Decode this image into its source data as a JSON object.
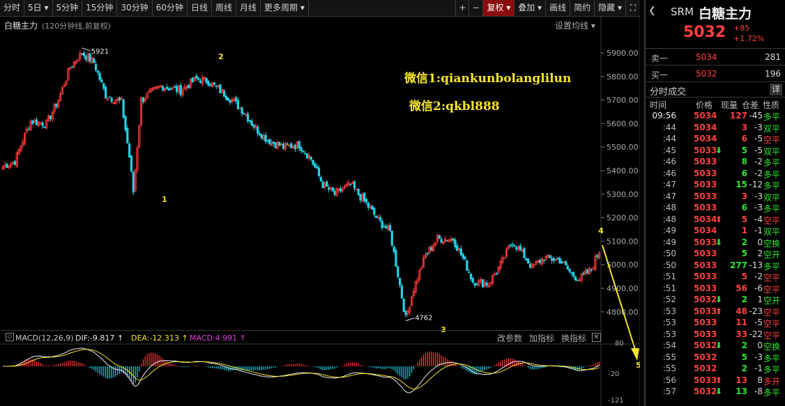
{
  "toolbar": {
    "buttons": [
      "分时",
      "5日 ▾",
      "5分钟",
      "15分钟",
      "30分钟",
      "60分钟",
      "日线",
      "周线",
      "月线",
      "更多周期 ▾"
    ],
    "plus": "+",
    "minus": "−",
    "fq": "复权 ▾",
    "overlay": "叠加 ▾",
    "draw": "画线",
    "simple": "简约",
    "hide": "隐藏 ▾",
    "maximize": "⛶"
  },
  "chart": {
    "title": "白糖主力",
    "subtitle": "(120分钟线,前复权)",
    "ma_setting": "设置均线 ▾",
    "y_ticks": [
      "5900.00",
      "5800.00",
      "5700.00",
      "5600.00",
      "5500.00",
      "5400.00",
      "5300.00",
      "5200.00",
      "5100.00",
      "5000.00",
      "4900.00",
      "4800.00"
    ],
    "high_label": "5921",
    "low_label": "4762",
    "wave_labels": [
      "1",
      "2",
      "3",
      "4",
      "5"
    ],
    "wechat1": "微信1:qiankunbolanglilun",
    "wechat2": "微信2:qkbl888",
    "colors": {
      "up": "#ff3b3b",
      "down": "#22d3e6",
      "annotation": "#f5e62a"
    }
  },
  "chart_data": {
    "type": "candlestick",
    "title": "白糖主力",
    "ylim": [
      4700,
      5960
    ],
    "high": 5921,
    "low": 4762,
    "waypoints": [
      [
        0,
        5420
      ],
      [
        6,
        5440
      ],
      [
        10,
        5530
      ],
      [
        14,
        5610
      ],
      [
        22,
        5600
      ],
      [
        28,
        5700
      ],
      [
        34,
        5840
      ],
      [
        40,
        5900
      ],
      [
        46,
        5860
      ],
      [
        52,
        5720
      ],
      [
        60,
        5690
      ],
      [
        64,
        5460
      ],
      [
        66,
        5310
      ],
      [
        70,
        5700
      ],
      [
        80,
        5760
      ],
      [
        90,
        5740
      ],
      [
        98,
        5790
      ],
      [
        104,
        5780
      ],
      [
        110,
        5740
      ],
      [
        116,
        5700
      ],
      [
        122,
        5650
      ],
      [
        128,
        5580
      ],
      [
        134,
        5530
      ],
      [
        142,
        5500
      ],
      [
        150,
        5510
      ],
      [
        156,
        5450
      ],
      [
        162,
        5340
      ],
      [
        168,
        5300
      ],
      [
        176,
        5340
      ],
      [
        184,
        5260
      ],
      [
        190,
        5190
      ],
      [
        196,
        5140
      ],
      [
        200,
        4960
      ],
      [
        204,
        4770
      ],
      [
        208,
        4900
      ],
      [
        214,
        5040
      ],
      [
        220,
        5110
      ],
      [
        228,
        5110
      ],
      [
        234,
        5010
      ],
      [
        238,
        4930
      ],
      [
        246,
        4920
      ],
      [
        252,
        5000
      ],
      [
        258,
        5100
      ],
      [
        262,
        5060
      ],
      [
        268,
        4990
      ],
      [
        274,
        5030
      ],
      [
        282,
        5020
      ],
      [
        288,
        4960
      ],
      [
        292,
        4940
      ],
      [
        298,
        4980
      ],
      [
        302,
        5060
      ]
    ],
    "macd": {
      "params": "MACD(12,26,9)",
      "DIF": -9.817,
      "DEA": -12.313,
      "MACD": 4.991,
      "y_ticks": [
        "80",
        "-20",
        "-121"
      ]
    }
  },
  "macd_bar": {
    "label": "MACD(12,26,9)",
    "dif": "DIF:-9.817 ↑",
    "dea": "DEA:-12.313 ↑",
    "macd": "MACD:4.991 ↑",
    "btn_params": "改参数",
    "btn_add": "加指标",
    "btn_switch": "换指标",
    "close": "✕"
  },
  "quote": {
    "code": "SRM",
    "name": "白糖主力",
    "price": "5032",
    "change": "+85",
    "change_pct": "+1.72%",
    "sell1_label": "卖一",
    "sell1_price": "5034",
    "sell1_vol": "281",
    "buy1_label": "买一",
    "buy1_price": "5032",
    "buy1_vol": "196"
  },
  "ticks": {
    "title": "分时成交",
    "detail": "详",
    "headers": [
      "时间",
      "价格",
      "现量",
      "仓差",
      "性质"
    ],
    "rows": [
      {
        "time": "09:56",
        "price": "5034",
        "arrow": "",
        "vol": "127",
        "oi": "-45",
        "nature": "多平",
        "vd": "up",
        "nd": "dn"
      },
      {
        "time": ":44",
        "price": "5034",
        "arrow": "",
        "vol": "3",
        "oi": "-3",
        "nature": "双平",
        "vd": "up",
        "nd": "dn"
      },
      {
        "time": ":44",
        "price": "5034",
        "arrow": "",
        "vol": "6",
        "oi": "-5",
        "nature": "空平",
        "vd": "up",
        "nd": "up"
      },
      {
        "time": ":45",
        "price": "5033",
        "arrow": "⬇",
        "vol": "5",
        "oi": "-5",
        "nature": "双平",
        "vd": "dn",
        "nd": "dn"
      },
      {
        "time": ":46",
        "price": "5033",
        "arrow": "",
        "vol": "8",
        "oi": "-2",
        "nature": "多平",
        "vd": "dn",
        "nd": "dn"
      },
      {
        "time": ":46",
        "price": "5033",
        "arrow": "",
        "vol": "6",
        "oi": "-2",
        "nature": "多平",
        "vd": "dn",
        "nd": "dn"
      },
      {
        "time": ":47",
        "price": "5033",
        "arrow": "",
        "vol": "15",
        "oi": "-12",
        "nature": "多平",
        "vd": "dn",
        "nd": "dn"
      },
      {
        "time": ":47",
        "price": "5033",
        "arrow": "",
        "vol": "3",
        "oi": "-3",
        "nature": "双平",
        "vd": "up",
        "nd": "dn"
      },
      {
        "time": ":48",
        "price": "5033",
        "arrow": "",
        "vol": "6",
        "oi": "-3",
        "nature": "多平",
        "vd": "dn",
        "nd": "dn"
      },
      {
        "time": ":48",
        "price": "5034",
        "arrow": "⬆",
        "vol": "5",
        "oi": "-4",
        "nature": "空平",
        "vd": "up",
        "nd": "up"
      },
      {
        "time": ":49",
        "price": "5034",
        "arrow": "",
        "vol": "1",
        "oi": "-1",
        "nature": "双平",
        "vd": "up",
        "nd": "dn"
      },
      {
        "time": ":49",
        "price": "5033",
        "arrow": "⬇",
        "vol": "2",
        "oi": "0",
        "nature": "空换",
        "vd": "dn",
        "nd": "dn"
      },
      {
        "time": ":50",
        "price": "5033",
        "arrow": "",
        "vol": "5",
        "oi": "2",
        "nature": "空开",
        "vd": "dn",
        "nd": "dn"
      },
      {
        "time": ":50",
        "price": "5033",
        "arrow": "",
        "vol": "277",
        "oi": "-13",
        "nature": "多平",
        "vd": "dn",
        "nd": "dn"
      },
      {
        "time": ":51",
        "price": "5033",
        "arrow": "",
        "vol": "5",
        "oi": "-2",
        "nature": "空平",
        "vd": "up",
        "nd": "up"
      },
      {
        "time": ":51",
        "price": "5033",
        "arrow": "",
        "vol": "56",
        "oi": "-6",
        "nature": "空平",
        "vd": "up",
        "nd": "up"
      },
      {
        "time": ":52",
        "price": "5032",
        "arrow": "⬇",
        "vol": "2",
        "oi": "1",
        "nature": "空开",
        "vd": "dn",
        "nd": "dn"
      },
      {
        "time": ":53",
        "price": "5033",
        "arrow": "⬆",
        "vol": "48",
        "oi": "-23",
        "nature": "空平",
        "vd": "up",
        "nd": "up"
      },
      {
        "time": ":53",
        "price": "5033",
        "arrow": "",
        "vol": "11",
        "oi": "-5",
        "nature": "空平",
        "vd": "up",
        "nd": "up"
      },
      {
        "time": ":53",
        "price": "5033",
        "arrow": "",
        "vol": "33",
        "oi": "-22",
        "nature": "空平",
        "vd": "up",
        "nd": "up"
      },
      {
        "time": ":54",
        "price": "5032",
        "arrow": "⬇",
        "vol": "2",
        "oi": "0",
        "nature": "空换",
        "vd": "dn",
        "nd": "dn"
      },
      {
        "time": ":55",
        "price": "5032",
        "arrow": "",
        "vol": "5",
        "oi": "-3",
        "nature": "多平",
        "vd": "dn",
        "nd": "dn"
      },
      {
        "time": ":55",
        "price": "5032",
        "arrow": "",
        "vol": "2",
        "oi": "-1",
        "nature": "多平",
        "vd": "dn",
        "nd": "dn"
      },
      {
        "time": ":56",
        "price": "5033",
        "arrow": "⬆",
        "vol": "13",
        "oi": "8",
        "nature": "多开",
        "vd": "up",
        "nd": "up"
      },
      {
        "time": ":57",
        "price": "5032",
        "arrow": "⬇",
        "vol": "13",
        "oi": "-8",
        "nature": "多平",
        "vd": "dn",
        "nd": "dn"
      }
    ]
  }
}
